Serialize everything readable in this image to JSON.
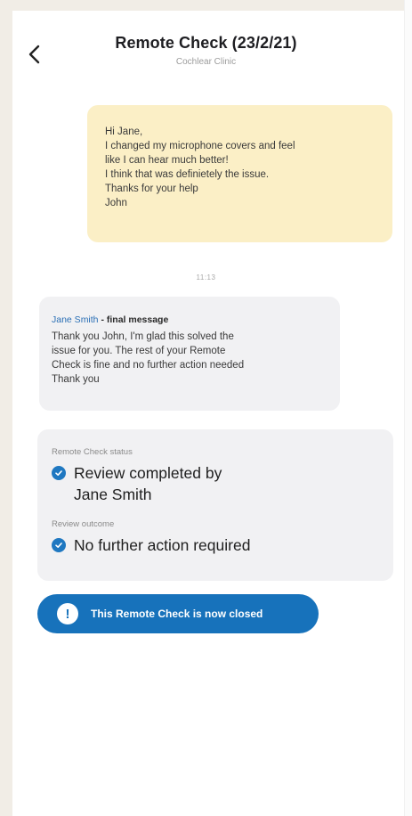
{
  "header": {
    "title": "Remote Check (23/2/21)",
    "subtitle": "Cochlear Clinic",
    "back_icon": "chevron-left-icon"
  },
  "messages": {
    "user": {
      "lines": [
        "Hi Jane,",
        "I changed my microphone covers and feel",
        "like I can hear much better!",
        "I think that was definietely the issue.",
        "Thanks for your help",
        "John"
      ]
    },
    "timestamp": "11:13",
    "staff": {
      "sender_name": "Jane Smith",
      "sender_suffix": " - final message",
      "lines": [
        "Thank you John, I'm glad this solved the",
        "issue for you. The rest of your Remote",
        "Check is fine and no further action needed",
        "Thank you"
      ]
    }
  },
  "status_card": {
    "status_label": "Remote Check status",
    "status_lines": [
      "Review completed by",
      "Jane Smith"
    ],
    "outcome_label": "Review outcome",
    "outcome_value": "No further action required",
    "check_icon": "check-circle-icon"
  },
  "banner": {
    "text": "This Remote Check is now closed",
    "icon": "exclamation-circle-icon"
  },
  "colors": {
    "user_bubble": "#fbefc6",
    "staff_bubble": "#f1f1f3",
    "accent_blue": "#1772bb",
    "sender_blue": "#2a6fb5"
  }
}
